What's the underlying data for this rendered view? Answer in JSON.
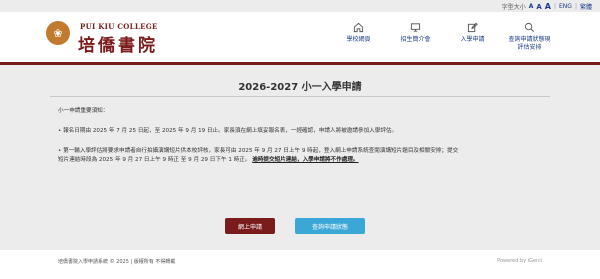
{
  "topbar": {
    "font_size_label": "字型大小",
    "font_small": "A",
    "font_medium": "A",
    "font_large": "A",
    "lang_en": "ENG",
    "separator": "|",
    "lang_tc": "繁體"
  },
  "header": {
    "school_en": "PUI KIU COLLEGE",
    "school_zh": "培僑書院",
    "logo_glyph": "❀"
  },
  "nav": [
    {
      "label": "學校網頁",
      "icon": "home-icon"
    },
    {
      "label": "招生簡介會",
      "icon": "monitor-icon"
    },
    {
      "label": "入學申請",
      "icon": "edit-icon"
    },
    {
      "label": "查詢申請狀態現\n評估安排",
      "icon": "search-icon",
      "has_dropdown": true
    }
  ],
  "main": {
    "title": "2026-2027 小一入學申請",
    "notice_heading": "小一申請重要須知：",
    "bullet1": "• 報名日期由 2025 年 7 月 25 日起，至 2025 年 9 月 19 日止。家長須在網上填妥報名表，一經確認，申請人將被邀請參加入學評估。",
    "bullet2_line1": "• 第一輪入學評估將要求申請者自行拍攝演講短片供本校評核，家長可由 2025 年 9 月 27 日上午 9 時起，登入網上申請系統查閱演講短片題目及相關安排；提交",
    "bullet2_line2": "短片連結時段為 2025 年 9 月 27 日上午 9 時正 至 9 月 29 日下午 1 時正。",
    "bullet2_link": "逾時提交短片連結，入學申請將不作處理。",
    "apply_button": "網上申請",
    "status_button": "查詢申請狀態"
  },
  "footer": {
    "copyright": "培僑書院入學申請系統 © 2025 | 版權所有 不得轉載",
    "powered": "Powered by iGenii"
  },
  "colors": {
    "brand": "#7a1c1c",
    "accent": "#3aa7d6",
    "nav": "#1a3a8a"
  }
}
